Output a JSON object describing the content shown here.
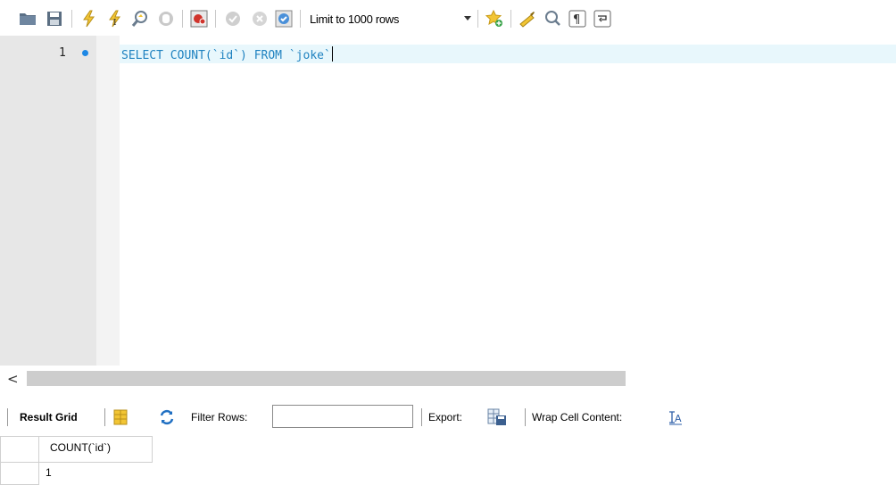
{
  "toolbar": {
    "icons": [
      "open-folder-icon",
      "save-icon",
      "execute-icon",
      "execute-current-icon",
      "explain-icon",
      "stop-icon",
      "toggle-stop-on-error-icon",
      "commit-icon",
      "rollback-icon",
      "autocommit-icon",
      "add-snippet-icon",
      "beautify-icon",
      "find-icon",
      "invisible-chars-icon",
      "word-wrap-icon"
    ],
    "limit_label": "Limit to 1000 rows"
  },
  "editor": {
    "line_number": "1",
    "query": "SELECT COUNT(`id`) FROM `joke`"
  },
  "scrollbar": {
    "left_arrow": "<"
  },
  "result_toolbar": {
    "result_grid_label": "Result Grid",
    "filter_label": "Filter Rows:",
    "filter_value": "",
    "export_label": "Export:",
    "wrap_label": "Wrap Cell Content:"
  },
  "grid": {
    "columns": [
      "COUNT(`id`)"
    ],
    "rows": [
      [
        "1"
      ]
    ]
  },
  "colors": {
    "gutter": "#e7e7e7",
    "current_line": "#e8f7fc",
    "keyword": "#1f82c0",
    "breakpoint_dot": "#1e88e5"
  }
}
